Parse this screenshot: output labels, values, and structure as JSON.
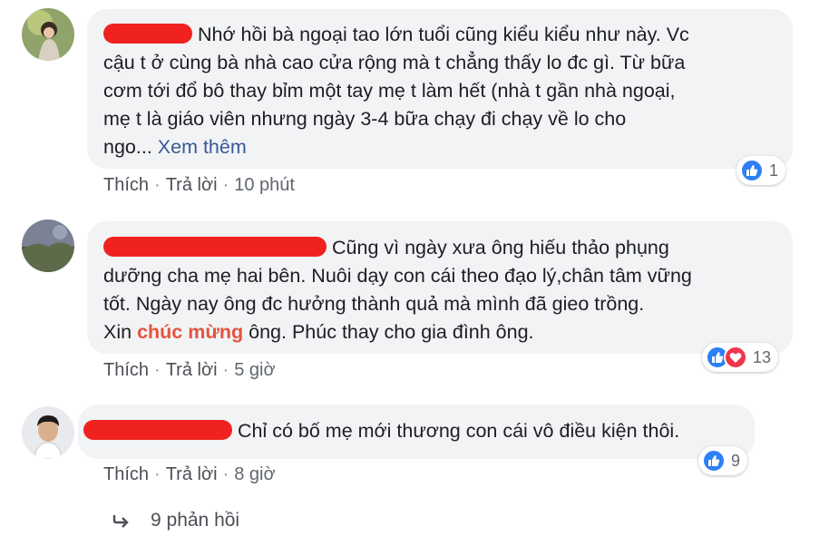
{
  "comments": [
    {
      "text_lines": [
        "Nhớ hồi bà ngoại tao lớn tuổi cũng kiểu kiểu như này. Vc",
        "cậu t ở cùng bà nhà cao cửa rộng mà t chẳng thấy lo đc gì. Từ bữa",
        "cơm tới đổ bô thay bỉm một tay mẹ t làm hết (nhà t gần nhà ngoại,",
        "mẹ t là giáo viên nhưng ngày 3-4 bữa chạy đi chạy về lo cho"
      ],
      "last_line_prefix": "ngo... ",
      "see_more": "Xem thêm",
      "like_label": "Thích",
      "reply_label": "Trả lời",
      "time": "10 phút",
      "reaction_count": "1"
    },
    {
      "text_lines": [
        "Cũng vì ngày xưa ông hiếu thảo phụng",
        "dưỡng cha mẹ hai bên. Nuôi dạy con cái theo đạo lý,chân tâm vững",
        "tốt. Ngày nay ông đc hưởng thành quả mà mình đã gieo trồng."
      ],
      "last_line_prefix": "Xin ",
      "highlight": "chúc mừng",
      "last_line_suffix": " ông. Phúc thay cho gia đình ông.",
      "like_label": "Thích",
      "reply_label": "Trả lời",
      "time": "5 giờ",
      "reaction_count": "13"
    },
    {
      "text": "Chỉ có bố mẹ mới thương con cái vô điều kiện thôi.",
      "like_label": "Thích",
      "reply_label": "Trả lời",
      "time": "8 giờ",
      "reaction_count": "9"
    }
  ],
  "replies_label": "9 phản hồi",
  "colors": {
    "bubble": "#f2f3f5",
    "redaction": "#f0221f",
    "link": "#385898",
    "highlight": "#e2543f",
    "like": "#2d7ff5",
    "love": "#f0364d"
  }
}
